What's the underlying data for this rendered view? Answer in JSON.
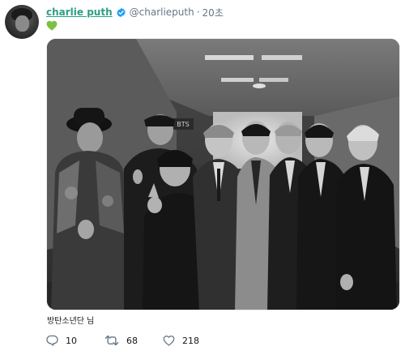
{
  "tweet": {
    "author": {
      "display_name": "charlie puth",
      "handle": "@charlieputh",
      "verified": true,
      "avatar_icon": "avatar"
    },
    "timestamp": "20초",
    "dot": "·",
    "text_emoji": "green-heart-icon",
    "media": {
      "type": "photo",
      "style": "black-and-white"
    },
    "caption": "방탄소년단 님",
    "actions": {
      "reply_count": "10",
      "retweet_count": "68",
      "like_count": "218"
    }
  },
  "colors": {
    "name_link": "#2e9e86",
    "verified_badge": "#1da1f2",
    "green_heart": "#7ac142",
    "muted_text": "#657786"
  }
}
